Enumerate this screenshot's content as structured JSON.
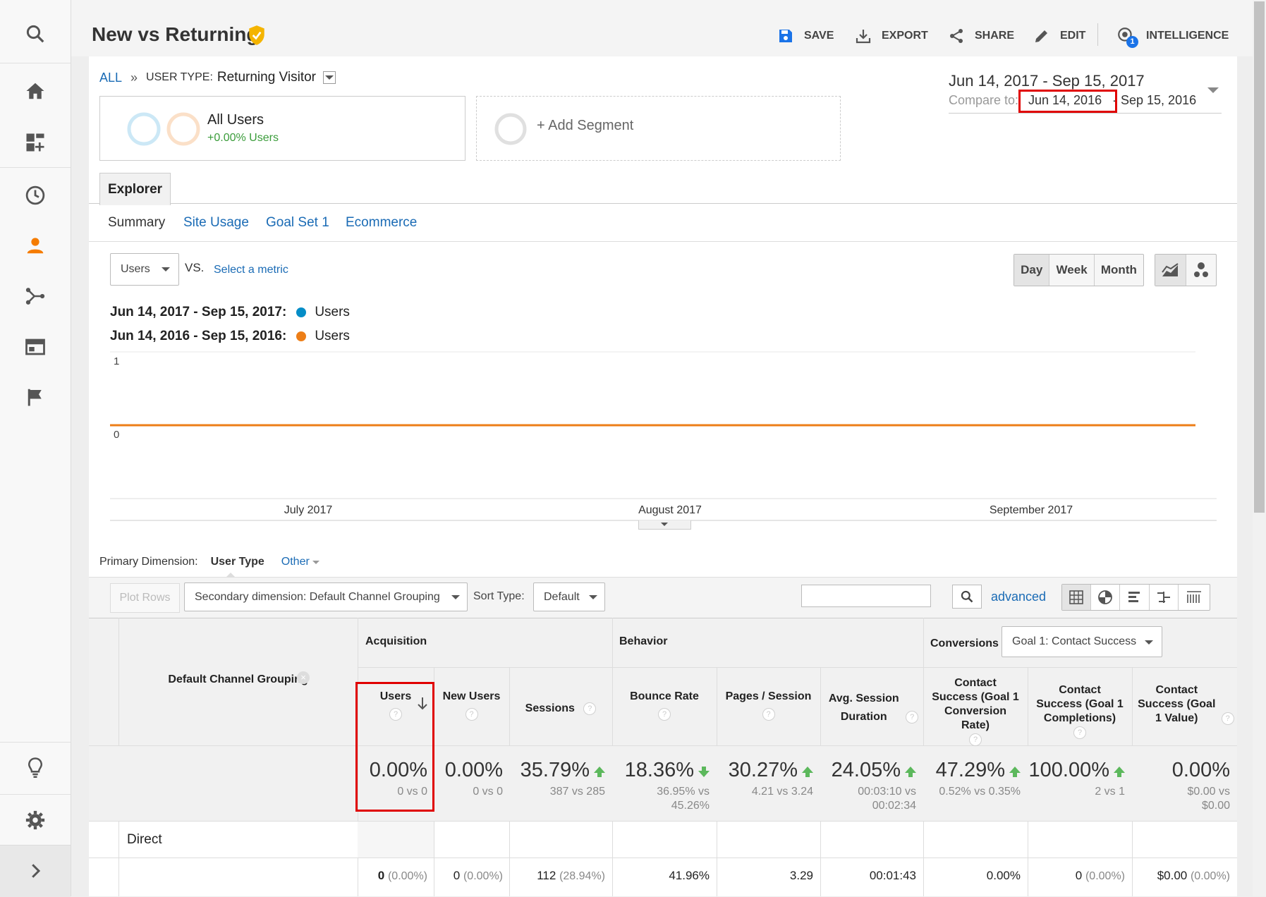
{
  "nav": {
    "icons": [
      "search-icon",
      "home-icon",
      "dashboard-add-icon",
      "clock-icon",
      "person-icon",
      "acquisition-icon",
      "behavior-icon",
      "flag-icon",
      "lightbulb-icon",
      "gear-icon",
      "chevron-right-icon"
    ],
    "active_color": "#f57c00"
  },
  "header": {
    "title": "New vs Returning",
    "buttons": {
      "save": "SAVE",
      "export": "EXPORT",
      "share": "SHARE",
      "edit": "EDIT",
      "intelligence": "INTELLIGENCE"
    },
    "intelligence_badge": "1"
  },
  "breadcrumb": {
    "all": "ALL",
    "separator": "»",
    "user_type_label": "USER TYPE:",
    "user_type_value": "Returning Visitor"
  },
  "date_range": {
    "primary": "Jun 14, 2017 - Sep 15, 2017",
    "compare_label": "Compare to:",
    "compare_start": "Jun 14, 2016",
    "compare_dash": "-",
    "compare_end": "Sep 15, 2016"
  },
  "segments": {
    "all_users": "All Users",
    "all_users_change": "+0.00% Users",
    "add_segment": "+ Add Segment"
  },
  "tabs": {
    "explorer": "Explorer",
    "sub": [
      "Summary",
      "Site Usage",
      "Goal Set 1",
      "Ecommerce"
    ]
  },
  "chart_controls": {
    "metric": "Users",
    "vs": "VS.",
    "select_metric": "Select a metric",
    "day": "Day",
    "week": "Week",
    "month": "Month"
  },
  "chart_data": {
    "type": "line",
    "legend": [
      {
        "label": "Jun 14, 2017 - Sep 15, 2017:",
        "series": "Users",
        "color": "#058dc7"
      },
      {
        "label": "Jun 14, 2016 - Sep 15, 2016:",
        "series": "Users",
        "color": "#ed7e17"
      }
    ],
    "yticks": [
      "1",
      "0"
    ],
    "ylim": [
      0,
      1
    ],
    "xticks": [
      "July 2017",
      "August 2017",
      "September 2017"
    ],
    "series": [
      {
        "name": "Users",
        "color": "#058dc7",
        "values": [
          0,
          0
        ]
      },
      {
        "name": "Users",
        "color": "#ed7e17",
        "values": [
          0,
          0
        ]
      }
    ]
  },
  "dimension": {
    "label": "Primary Dimension:",
    "active": "User Type",
    "other": "Other"
  },
  "table_controls": {
    "plot_rows": "Plot Rows",
    "secondary": "Secondary dimension: Default Channel Grouping",
    "sort_label": "Sort Type:",
    "sort_value": "Default",
    "advanced": "advanced",
    "search_value": ""
  },
  "table": {
    "dim_header": "Default Channel Grouping",
    "groups": {
      "acquisition": "Acquisition",
      "behavior": "Behavior",
      "conversions": "Conversions",
      "goal_select": "Goal 1: Contact Success"
    },
    "columns": [
      {
        "label": "Users",
        "total": "0.00%",
        "sub": "0 vs 0",
        "trend": "none",
        "row": "0",
        "row_pct": "(0.00%)"
      },
      {
        "label": "New Users",
        "total": "0.00%",
        "sub": "0 vs 0",
        "trend": "none",
        "row": "0",
        "row_pct": "(0.00%)"
      },
      {
        "label": "Sessions",
        "total": "35.79%",
        "sub": "387 vs 285",
        "trend": "up",
        "row": "112",
        "row_pct": "(28.94%)"
      },
      {
        "label": "Bounce Rate",
        "total": "18.36%",
        "sub": "36.95% vs 45.26%",
        "trend": "down",
        "row": "41.96%",
        "row_pct": ""
      },
      {
        "label": "Pages / Session",
        "total": "30.27%",
        "sub": "4.21 vs 3.24",
        "trend": "up",
        "row": "3.29",
        "row_pct": ""
      },
      {
        "label": "Avg. Session Duration",
        "total": "24.05%",
        "sub": "00:03:10 vs 00:02:34",
        "trend": "up",
        "row": "00:01:43",
        "row_pct": ""
      },
      {
        "label": "Contact Success (Goal 1 Conversion Rate)",
        "total": "47.29%",
        "sub": "0.52% vs 0.35%",
        "trend": "up",
        "row": "0.00%",
        "row_pct": ""
      },
      {
        "label": "Contact Success (Goal 1 Completions)",
        "total": "100.00%",
        "sub": "2 vs 1",
        "trend": "up",
        "row": "0",
        "row_pct": "(0.00%)"
      },
      {
        "label": "Contact Success (Goal 1 Value)",
        "total": "0.00%",
        "sub": "$0.00 vs $0.00",
        "trend": "none",
        "row": "$0.00",
        "row_pct": "(0.00%)"
      }
    ],
    "row_label": "Direct"
  },
  "highlight_color": "#e00000"
}
